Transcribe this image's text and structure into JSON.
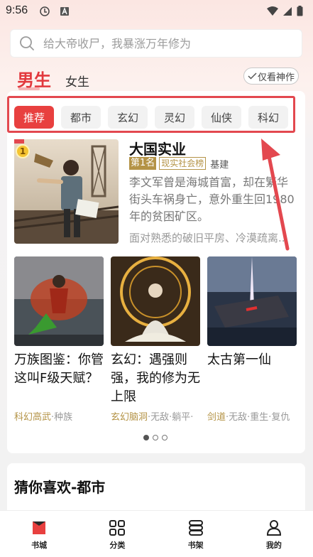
{
  "status_bar": {
    "time": "9:56",
    "colors": {
      "icons": "#222222"
    }
  },
  "search": {
    "placeholder": "给大帝收尸，我暴涨万年修为",
    "icon": "search-icon"
  },
  "gender_tabs": {
    "male": "男生",
    "female": "女生"
  },
  "filter": {
    "only_classics": "仅看神作"
  },
  "categories": [
    "推荐",
    "都市",
    "玄幻",
    "灵幻",
    "仙侠",
    "科幻"
  ],
  "selected_category": "推荐",
  "featured": {
    "rank": "1",
    "title": "大国实业",
    "rank_tag": "第1名",
    "list_tag": "现实社会榜",
    "extra_tag": "基建",
    "description": "李文军曾是海城首富，却在繁华街头车祸身亡，意外重生回1980年的贫困矿区。",
    "description_more": "面对熟悉的破旧平房、冷漠疏离..."
  },
  "grid_books": [
    {
      "title": "万族图鉴：你管这叫F级天赋？",
      "tag_highlight": "科幻高武",
      "tags": "·种族"
    },
    {
      "title": "玄幻：遇强则强，我的修为无上限",
      "tag_highlight": "玄幻脑洞",
      "tags": "·无敌·躺平·"
    },
    {
      "title": "太古第一仙",
      "tag_highlight": "剑道",
      "tags": "·无敌·重生·复仇"
    }
  ],
  "pagination": {
    "pages": 3,
    "current": 1
  },
  "guess": {
    "title": "猜你喜欢-都市"
  },
  "bottom_nav": [
    {
      "label": "书城",
      "icon": "bookstore-icon"
    },
    {
      "label": "分类",
      "icon": "category-grid-icon"
    },
    {
      "label": "书架",
      "icon": "bookshelf-icon"
    },
    {
      "label": "我的",
      "icon": "profile-icon"
    }
  ],
  "colors": {
    "accent": "#e8403f",
    "gold": "#b49346",
    "annotation": "#e3484f"
  }
}
